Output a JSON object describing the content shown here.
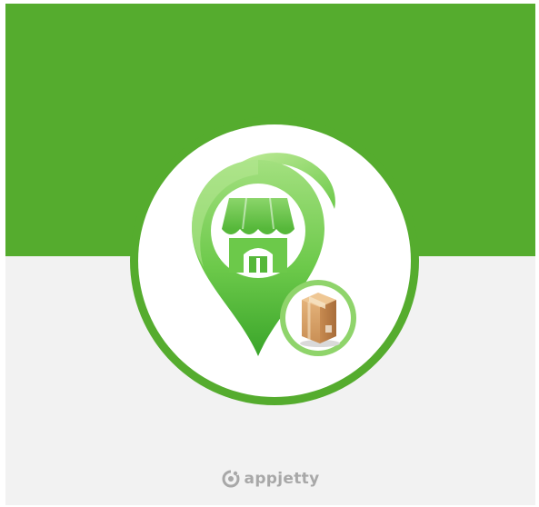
{
  "brand": {
    "name": "appjetty",
    "logo_icon": "appjetty-logo-icon"
  },
  "emblem": {
    "icon": "store-location-pin-icon",
    "badge_icon": "package-box-icon"
  },
  "colors": {
    "brand_green": "#55ac2e",
    "pin_green_light": "#9be07a",
    "pin_green_dark": "#3ea82a",
    "background_light": "#f2f2f2",
    "logo_gray": "#a8a8a8"
  }
}
